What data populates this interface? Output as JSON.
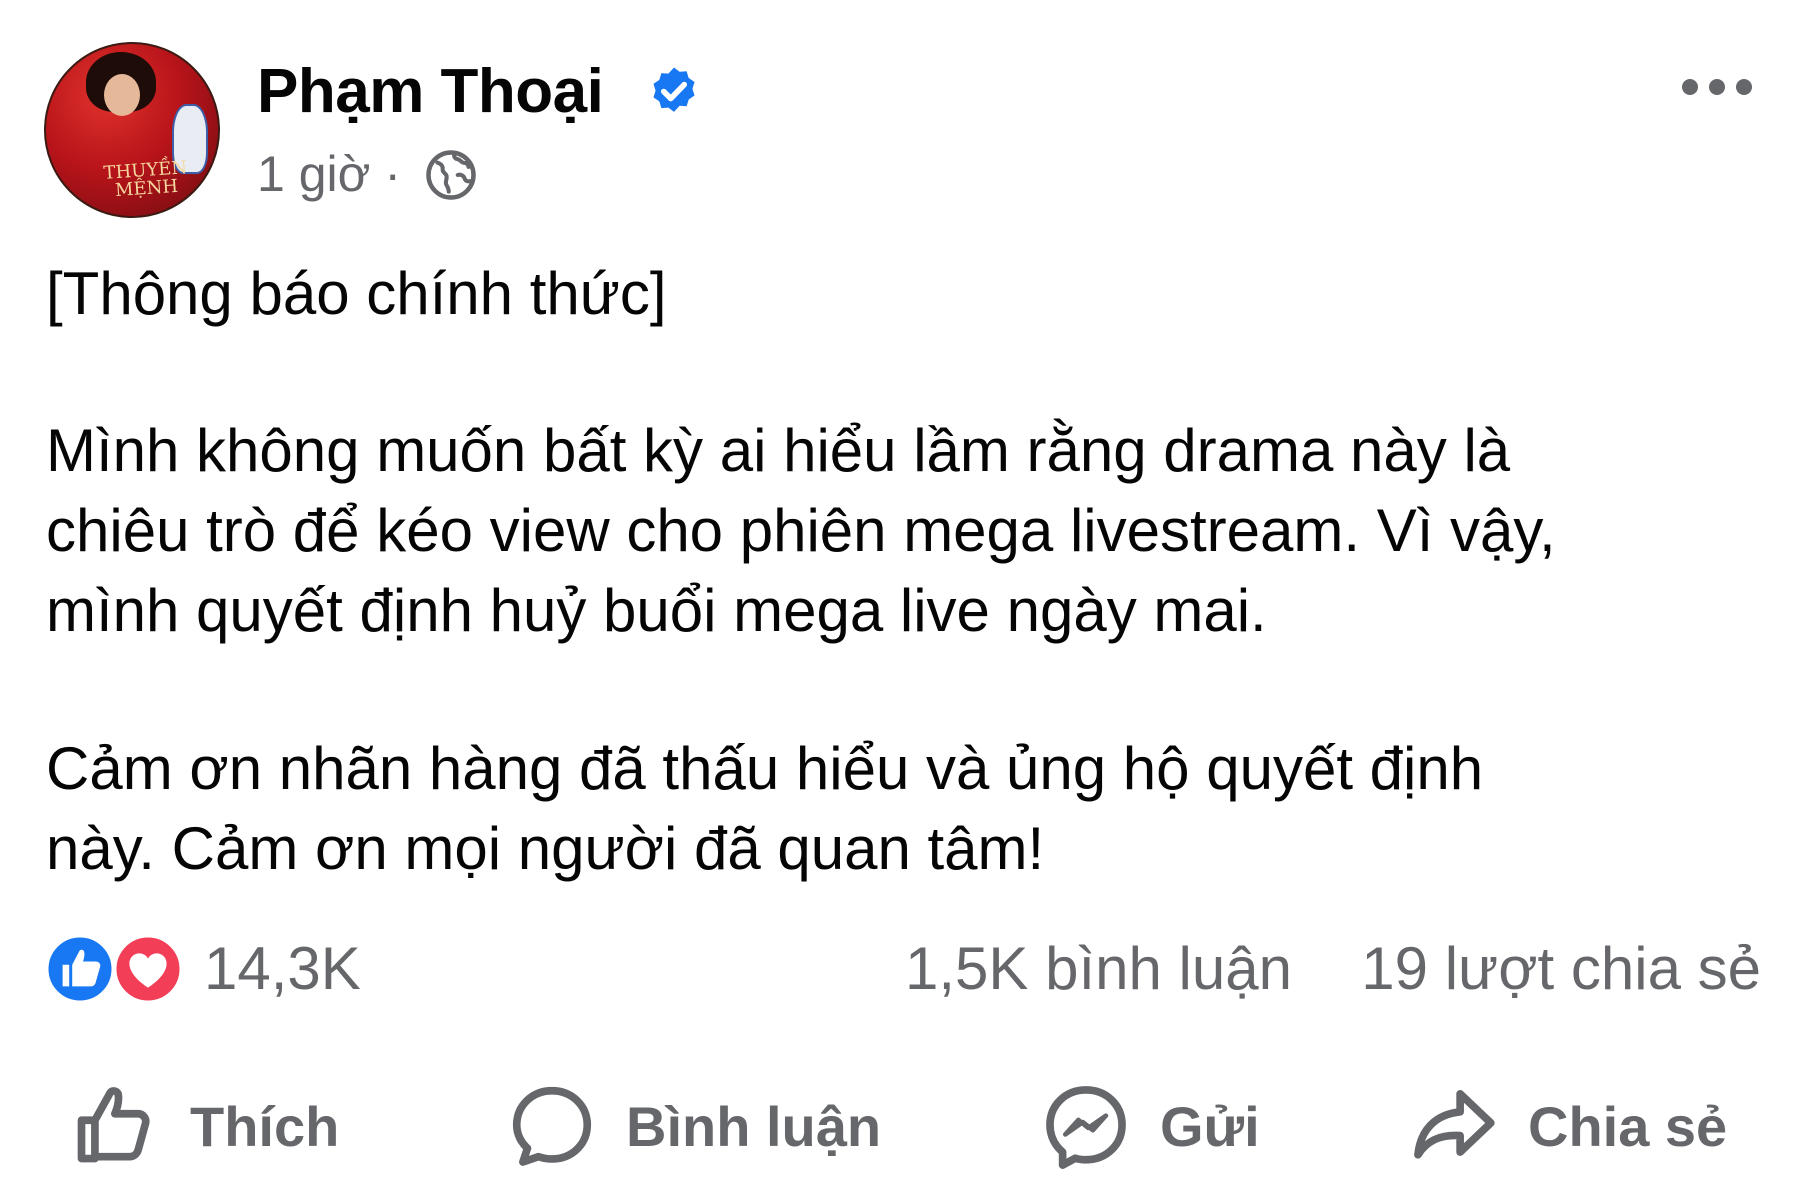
{
  "post": {
    "author": "Phạm Thoại",
    "time": "1 giờ",
    "separator": "·",
    "avatar_text": "THUYỀN MỆNH",
    "body": {
      "title": "[Thông báo chính thức]",
      "paragraph1_lines": [
        "Mình không muốn bất kỳ ai hiểu lầm rằng drama này là",
        "chiêu trò để kéo view cho phiên mega livestream. Vì vậy,",
        "mình quyết định huỷ buổi mega live ngày mai."
      ],
      "paragraph2_lines": [
        "Cảm ơn nhãn hàng đã thấu hiểu và ủng hộ quyết định",
        "này. Cảm ơn mọi người đã quan tâm!"
      ]
    },
    "stats": {
      "reactions": "14,3K",
      "comments": "1,5K bình luận",
      "shares": "19 lượt chia sẻ"
    },
    "actions": {
      "like": "Thích",
      "comment": "Bình luận",
      "send": "Gửi",
      "share": "Chia sẻ"
    }
  },
  "colors": {
    "verified_blue": "#1877f2",
    "like_blue": "#1877f2",
    "love_red": "#f33e58",
    "secondary_text": "#65676b"
  },
  "icons": [
    "verified-badge-icon",
    "globe-icon",
    "more-options-icon",
    "like-reaction-icon",
    "love-reaction-icon",
    "thumbs-up-icon",
    "comment-bubble-icon",
    "messenger-icon",
    "share-arrow-icon"
  ]
}
